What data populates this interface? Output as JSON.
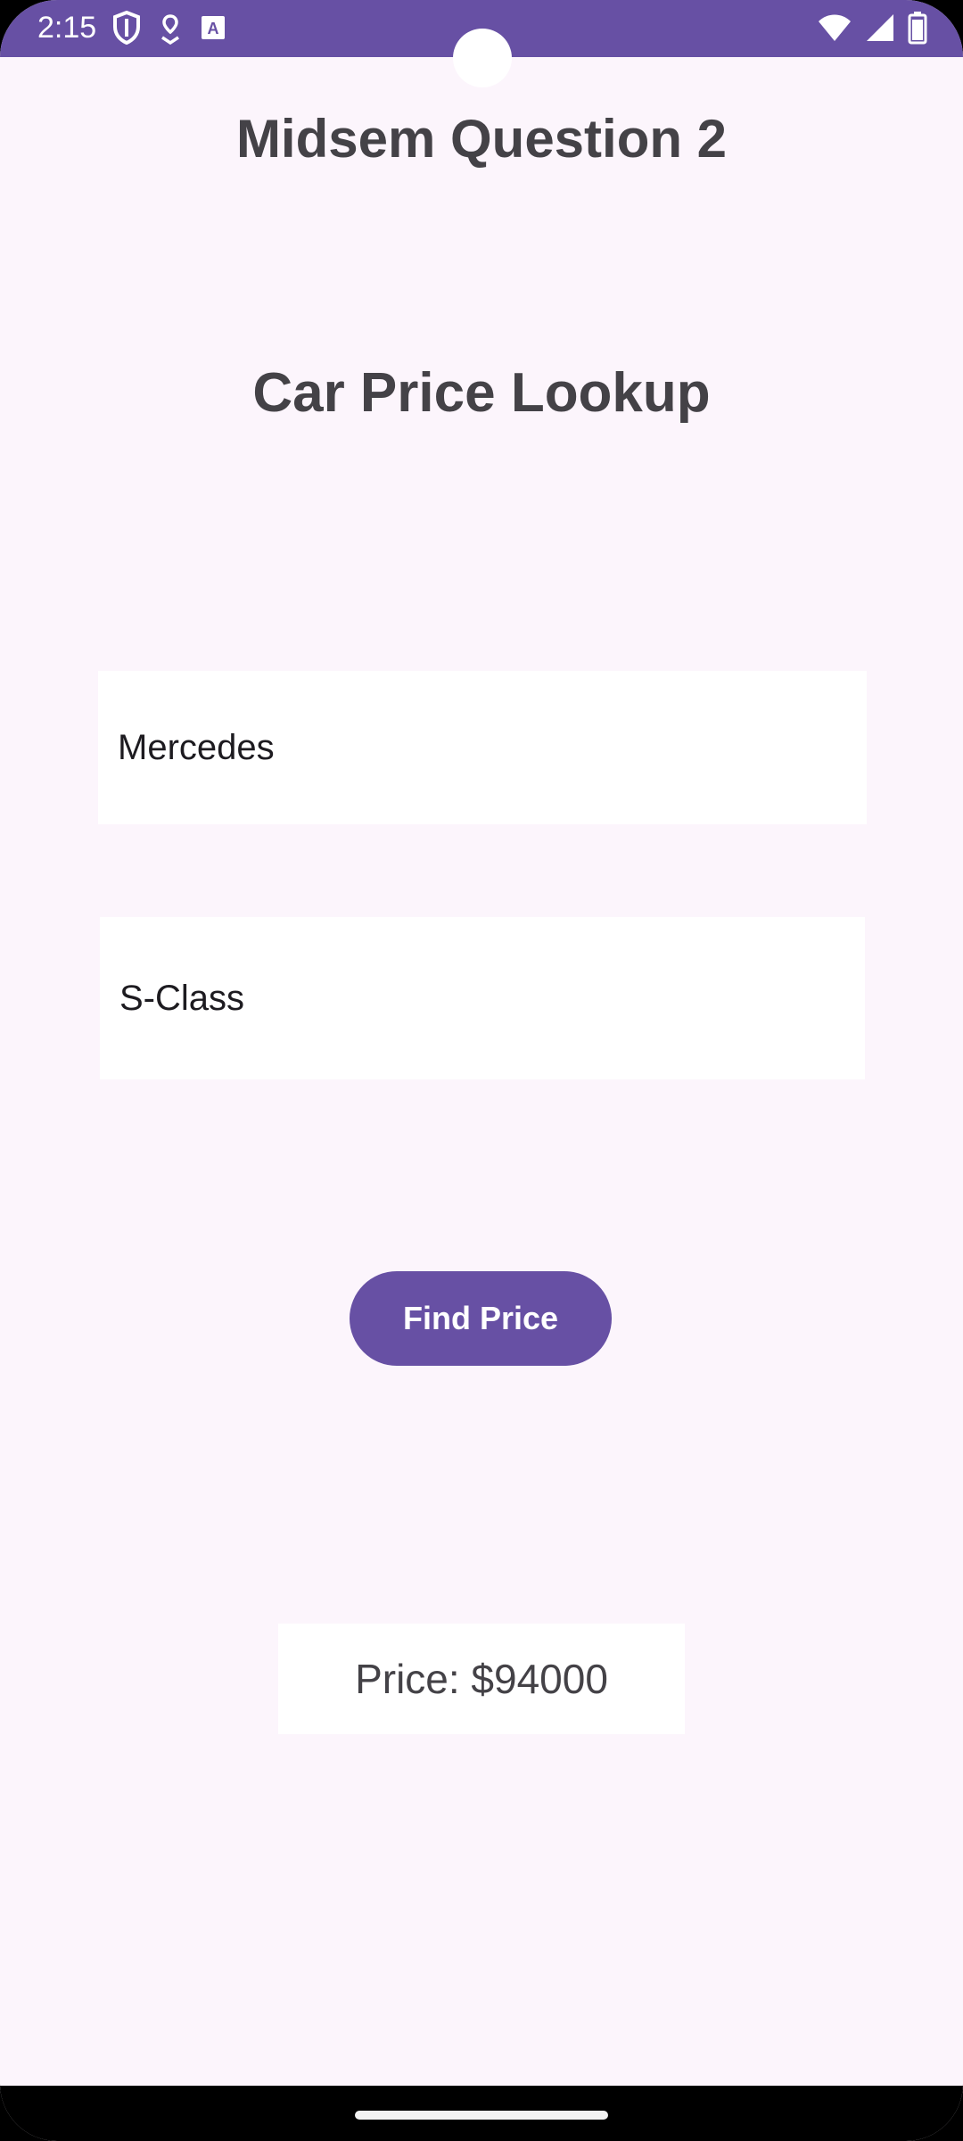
{
  "status_bar": {
    "time": "2:15",
    "left_icons": [
      "shield-icon",
      "location-pin-icon",
      "keyboard-a-icon"
    ],
    "right_icons": [
      "wifi-icon",
      "signal-icon",
      "battery-icon"
    ],
    "color": "#6750a4"
  },
  "app": {
    "title": "Midsem Question 2",
    "heading": "Car Price Lookup"
  },
  "form": {
    "make_value": "Mercedes",
    "model_value": "S-Class",
    "find_button_label": "Find Price"
  },
  "result": {
    "text": "Price: $94000"
  },
  "colors": {
    "accent": "#6750a4",
    "background": "#fcf5fc",
    "text_dark": "#444247"
  }
}
